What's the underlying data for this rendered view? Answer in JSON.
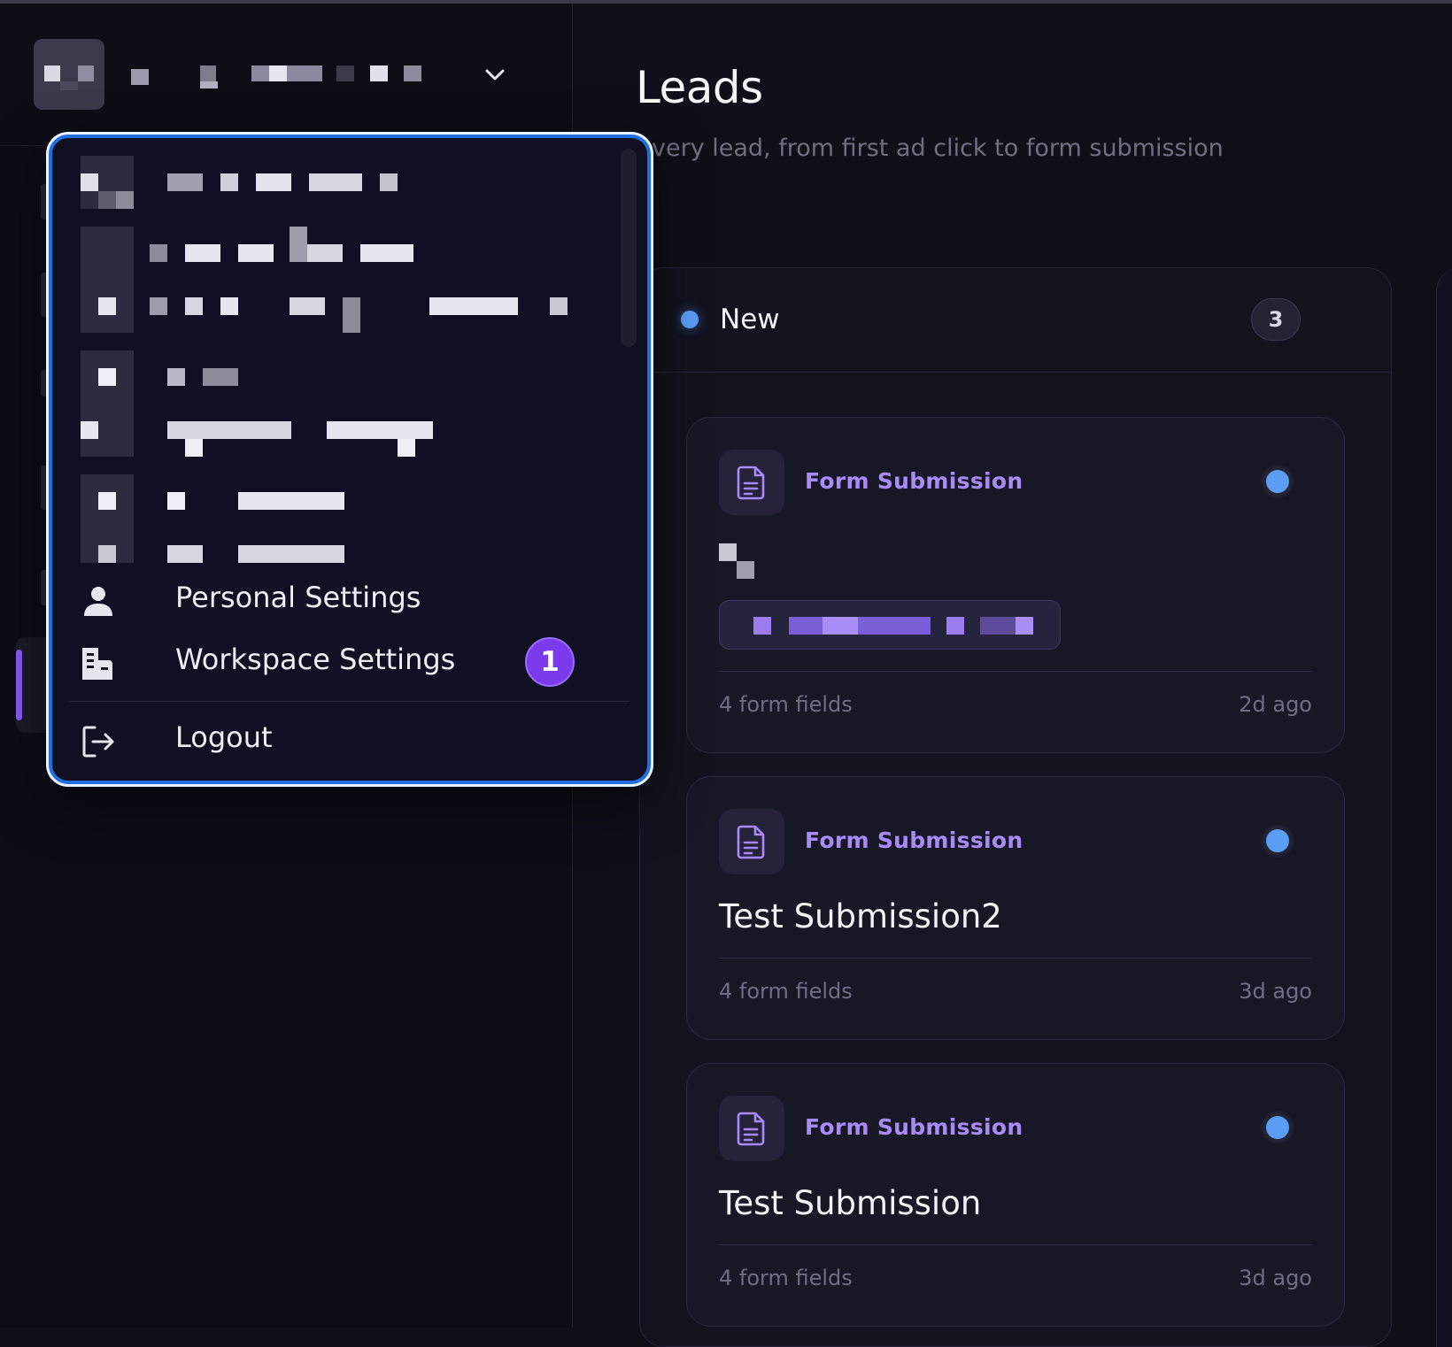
{
  "page": {
    "title": "Leads",
    "subtitle": "very lead, from first ad click to form submission"
  },
  "column": {
    "title": "New",
    "count": "3",
    "status_color": "#5b9cf5"
  },
  "cards": [
    {
      "type": "Form Submission",
      "title": "",
      "meta": "4 form fields",
      "time": "2d ago"
    },
    {
      "type": "Form Submission",
      "title": "Test Submission2",
      "meta": "4 form fields",
      "time": "3d ago"
    },
    {
      "type": "Form Submission",
      "title": "Test Submission",
      "meta": "4 form fields",
      "time": "3d ago"
    }
  ],
  "dropdown": {
    "items": [
      {
        "label": "Personal Settings",
        "icon": "person-icon"
      },
      {
        "label": "Workspace Settings",
        "icon": "building-icon",
        "badge": "1"
      },
      {
        "label": "Logout",
        "icon": "logout-icon"
      }
    ]
  },
  "colors": {
    "accent": "#8b5cf6",
    "badge": "#7c3aed",
    "focus_ring": "#1f6fe0",
    "link_purple": "#a78bfa"
  }
}
